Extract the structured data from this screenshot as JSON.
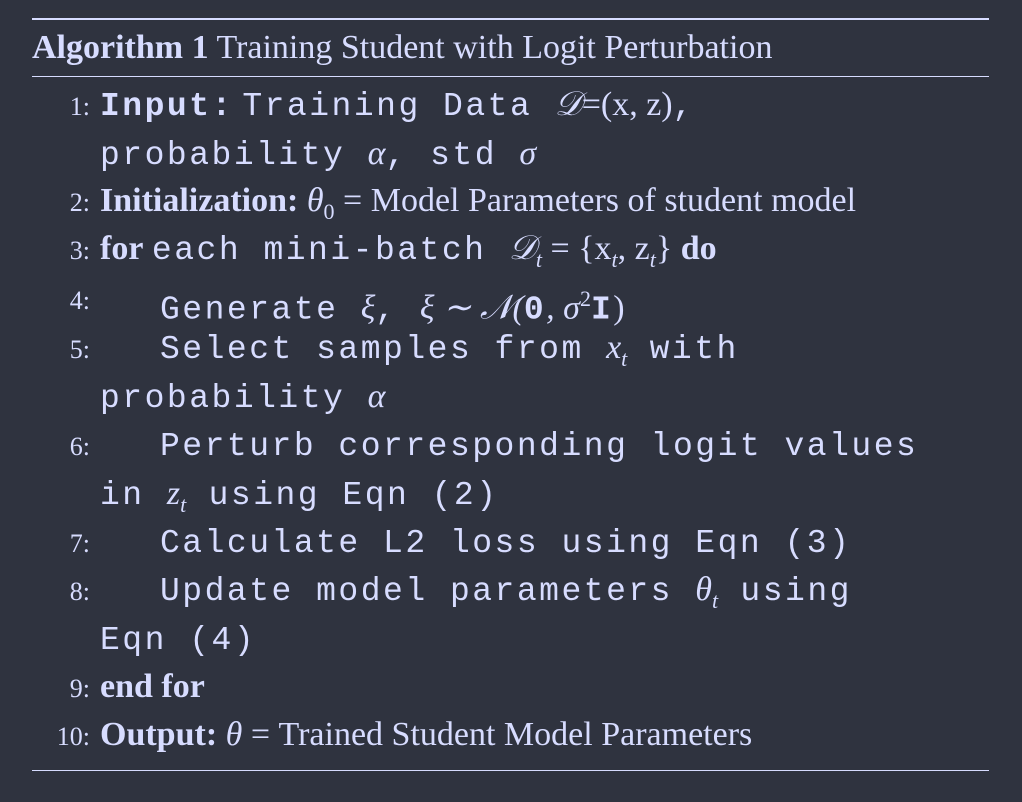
{
  "caption": {
    "label": "Algorithm 1",
    "title": "Training Student with Logit Perturbation"
  },
  "lines": [
    {
      "num": "1:",
      "keyword": "Input:",
      "text1": "Training Data ",
      "math1": "𝒟",
      "math1_rest": "=(x, z)",
      "text2": ",",
      "cont": "probability ",
      "cont_m1": "α",
      "cont_t2": ", std ",
      "cont_m2": "σ"
    },
    {
      "num": "2:",
      "keyword": "Initialization:",
      "math_theta": "θ",
      "sub": "0",
      "text": "= Model Parameters of student model"
    },
    {
      "num": "3:",
      "keyword": "for",
      "text": "each mini-batch ",
      "math": "𝒟",
      "sub": "t",
      "math_rest": " = {x",
      "sub2": "t",
      "math_rest2": ", z",
      "sub3": "t",
      "math_rest3": "}",
      "keyword2": "do"
    },
    {
      "num": "4:",
      "text": "Generate ",
      "m1": "ξ",
      "t2": ", ",
      "m2": "ξ ∼ 𝒩(",
      "bold0": "0",
      "m3": ", σ",
      "sup": "2",
      "boldI": "I",
      "m4": ")"
    },
    {
      "num": "5:",
      "text": "Select samples from ",
      "m1": "x",
      "sub": "t",
      "text2": " with",
      "cont": "probability ",
      "cont_m": "α"
    },
    {
      "num": "6:",
      "text": "Perturb corresponding logit values",
      "cont": "in ",
      "cont_m": "z",
      "cont_sub": "t",
      "cont_t2": " using Eqn (2)"
    },
    {
      "num": "7:",
      "text": "Calculate L2 loss using Eqn (3)"
    },
    {
      "num": "8:",
      "text": "Update model parameters ",
      "m": "θ",
      "sub": "t",
      "text2": " using",
      "cont": "Eqn (4)"
    },
    {
      "num": "9:",
      "keyword": "end for"
    },
    {
      "num": "10:",
      "keyword": "Output:",
      "m": "θ",
      "text": " = Trained Student Model Parameters"
    }
  ]
}
